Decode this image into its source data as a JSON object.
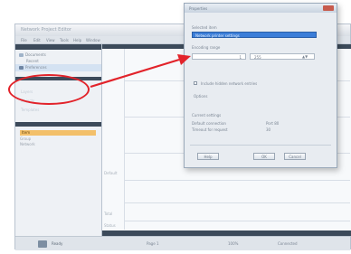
{
  "app": {
    "title": "Network Project Editor",
    "menu": [
      "File",
      "Edit",
      "View",
      "Tools",
      "Help",
      "Window"
    ]
  },
  "left_panel": {
    "nav_items": [
      {
        "label": "Documents",
        "icon": "document-icon"
      },
      {
        "label": "Recent"
      },
      {
        "label": "Preferences",
        "icon": "gear-icon"
      }
    ],
    "pale_items": [
      "Layers",
      "Objects",
      "Templates"
    ],
    "selected_item": "Item",
    "list_items": [
      "Group",
      "Network"
    ]
  },
  "center": {
    "row_labels": [
      "Default",
      "Total",
      "Status"
    ]
  },
  "status_bar": {
    "items": [
      "Ready",
      "Page 1",
      "100%",
      "Connected"
    ]
  },
  "dialog": {
    "title": "Properties",
    "combo_label": "Selected item",
    "combo_value": "Network printer settings",
    "section_label": "Encoding range",
    "from_value": "1",
    "to_value": "255",
    "checkbox_label": "Include hidden network entries",
    "option_label": "Options",
    "info_header": "Current settings",
    "info_rows": [
      {
        "label": "Default connection",
        "value": "Port 80"
      },
      {
        "label": "Timeout for request",
        "value": "30"
      }
    ],
    "buttons": {
      "help": "Help",
      "ok": "OK",
      "cancel": "Cancel"
    }
  },
  "annotation": {
    "color": "#e2232a"
  }
}
